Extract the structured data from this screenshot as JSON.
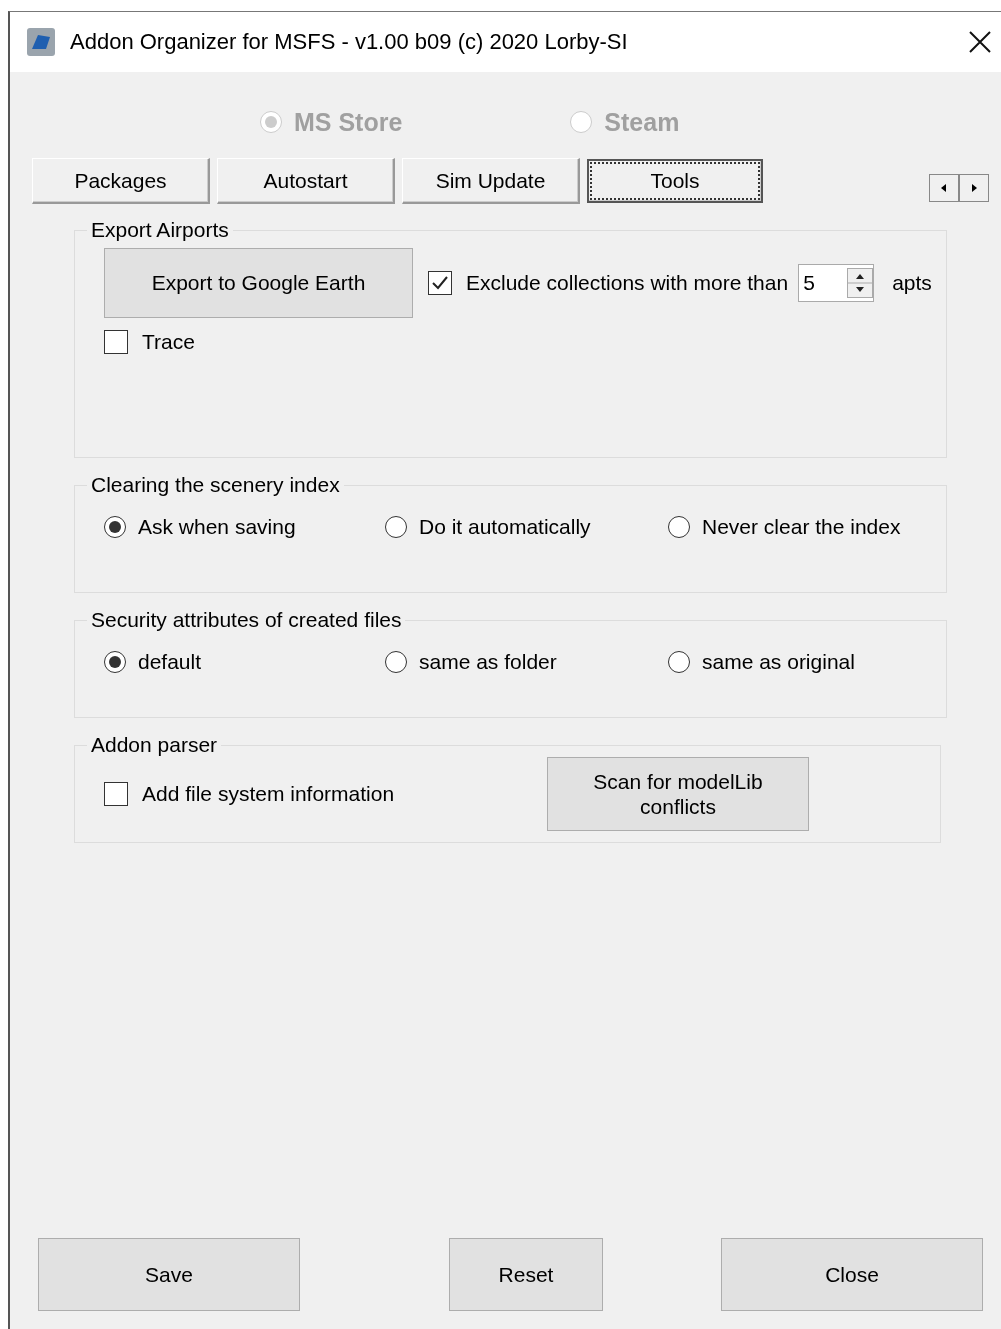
{
  "window": {
    "title": "Addon Organizer for MSFS - v1.00 b09 (c) 2020 Lorby-SI"
  },
  "source": {
    "disabled": true,
    "options": [
      {
        "label": "MS Store",
        "selected": true
      },
      {
        "label": "Steam",
        "selected": false
      }
    ]
  },
  "tabs": [
    {
      "label": "Packages",
      "selected": false
    },
    {
      "label": "Autostart",
      "selected": false
    },
    {
      "label": "Sim Update",
      "selected": false
    },
    {
      "label": "Tools",
      "selected": true
    }
  ],
  "export_airports": {
    "title": "Export Airports",
    "button": "Export to Google Earth",
    "exclude": {
      "label": "Exclude collections with more than",
      "checked": true,
      "value": "5",
      "unit": "apts"
    },
    "trace": {
      "label": "Trace",
      "checked": false
    }
  },
  "radio_groups": [
    {
      "title": "Clearing the scenery index",
      "options": [
        {
          "label": "Ask when saving",
          "selected": true
        },
        {
          "label": "Do it automatically",
          "selected": false
        },
        {
          "label": "Never clear the index",
          "selected": false
        }
      ]
    },
    {
      "title": "Security attributes of created files",
      "options": [
        {
          "label": "default",
          "selected": true
        },
        {
          "label": "same as folder",
          "selected": false
        },
        {
          "label": "same as original",
          "selected": false
        }
      ]
    }
  ],
  "addon_parser": {
    "title": "Addon parser",
    "checkbox": {
      "label": "Add file system information",
      "checked": false
    },
    "button": "Scan for modelLib conflicts"
  },
  "buttons": [
    "Save",
    "Reset",
    "Close"
  ]
}
